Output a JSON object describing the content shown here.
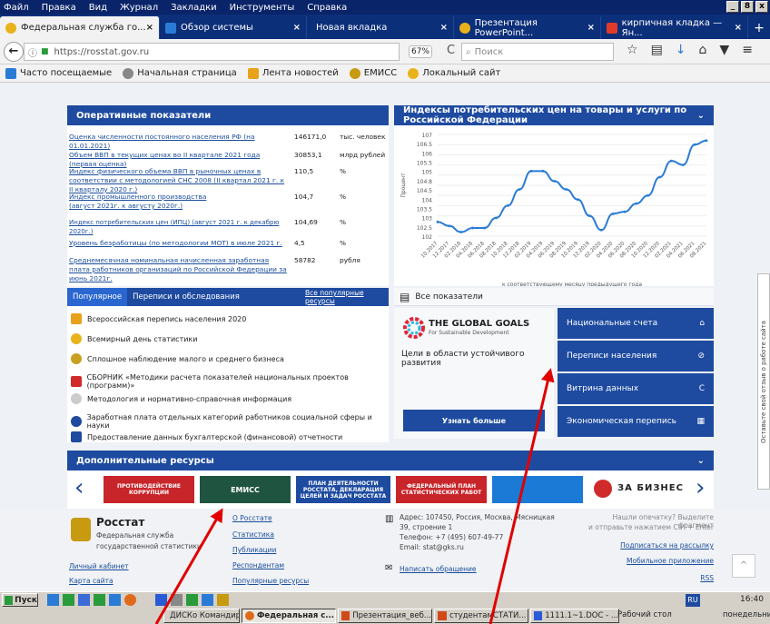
{
  "menu": [
    "Файл",
    "Правка",
    "Вид",
    "Журнал",
    "Закладки",
    "Инструменты",
    "Справка"
  ],
  "window_buttons": [
    "_",
    "8",
    "x"
  ],
  "tabs": [
    {
      "label": "Федеральная служба го...",
      "close": "×",
      "color": "#e8b31a"
    },
    {
      "label": "Обзор системы",
      "close": "×",
      "color": "#2a7bd6"
    },
    {
      "label": "Новая вкладка",
      "close": "×",
      "color": ""
    },
    {
      "label": "Презентация PowerPoint...",
      "close": "×",
      "color": "#e8b31a"
    },
    {
      "label": "кирпичная кладка — Ян...",
      "close": "×",
      "color": "#e03a2a"
    }
  ],
  "new_tab": "+",
  "nav": {
    "back": "←",
    "info": "ⓘ",
    "url": "https://rosstat.gov.ru",
    "zoom": "67%",
    "reload": "C",
    "search_placeholder": "Поиск",
    "icons": [
      "☆",
      "▤",
      "↓",
      "⌂",
      "▼",
      "≡"
    ]
  },
  "bookmarks": [
    {
      "label": "Часто посещаемые",
      "color": "#2a7bd6"
    },
    {
      "label": "Начальная страница",
      "color": "#888"
    },
    {
      "label": "Лента новостей",
      "color": "#e8a21a"
    },
    {
      "label": "ЕМИСС",
      "color": "#c89a10"
    },
    {
      "label": "Локальный сайт",
      "color": "#e8b31a"
    }
  ],
  "indicators": {
    "title": "Оперативные показатели",
    "rows": [
      {
        "label": "Оценка численности постоянного населения РФ (на 01.01.2021)",
        "value": "146171,0",
        "unit": "тыс. человек"
      },
      {
        "label": "Объем ВВП в текущих ценах во II квартале 2021 года (первая оценка)",
        "value": "30853,1",
        "unit": "млрд рублей"
      },
      {
        "label": "Индекс физического объема ВВП в рыночных ценах в соответствии с методологией СНС 2008 (II квартал 2021 г. к II кварталу 2020 г.)",
        "value": "110,5",
        "unit": "%"
      },
      {
        "label": "Индекс промышленного производства (август 2021г. к августу 2020г.)",
        "value": "104,7",
        "unit": "%"
      },
      {
        "label": "Индекс потребительских цен (ИПЦ) (август 2021 г. к декабрю 2020г.)",
        "value": "104,69",
        "unit": "%"
      },
      {
        "label": "Уровень безработицы (по методологии МОТ) в июле 2021 г.",
        "value": "4,5",
        "unit": "%"
      },
      {
        "label": "Среднемесячная номинальная начисленная заработная плата работников организаций по Российской Федерации за июнь 2021г.",
        "value": "58782",
        "unit": "рубля"
      }
    ]
  },
  "cpi_panel": {
    "title": "Индексы потребительских цен на товары и услуги по Российской Федерации",
    "chevron": "⌄"
  },
  "chart_data": {
    "type": "line",
    "title": "",
    "ylabel": "Процент",
    "xlabel": "к соответствующему месяцу предыдущего года",
    "ylim": [
      102,
      107
    ],
    "yticks": [
      "107",
      "106.5",
      "106",
      "105.5",
      "105",
      "104.8",
      "104.5",
      "104",
      "103.5",
      "103",
      "102.5",
      "102"
    ],
    "x": [
      "10.2017",
      "12.2017",
      "02.2018",
      "04.2018",
      "06.2018",
      "08.2018",
      "10.2018",
      "12.2018",
      "02.2019",
      "04.2019",
      "06.2019",
      "08.2019",
      "10.2019",
      "12.2019",
      "02.2020",
      "04.2020",
      "06.2020",
      "08.2020",
      "10.2020",
      "12.2020",
      "02.2021",
      "04.2021",
      "06.2021",
      "08.2021"
    ],
    "series": [
      {
        "values": [
          102.7,
          102.5,
          102.2,
          102.4,
          102.4,
          102.9,
          103.5,
          104.3,
          105.2,
          105.2,
          104.7,
          104.3,
          103.8,
          103.0,
          102.3,
          103.1,
          103.2,
          103.6,
          104.0,
          104.9,
          105.7,
          105.5,
          106.5,
          106.7
        ]
      }
    ],
    "line_color": "#2a7bd6",
    "grid": true
  },
  "popular": {
    "tab_active": "Популярное",
    "tab_other": "Переписи и обследования",
    "all_link": "Все популярные ресурсы",
    "items": [
      {
        "label": "Всероссийская перепись населения 2020",
        "color": "#e8a21a"
      },
      {
        "label": "Всемирный день статистики",
        "color": "#e8b31a"
      },
      {
        "label": "Сплошное наблюдение малого и среднего бизнеса",
        "color": "#c9a020"
      },
      {
        "label": "СБОРНИК «Методики расчета показателей национальных проектов (программ)»",
        "color": "#d02a2a"
      },
      {
        "label": "Методология и нормативно-справочная информация",
        "color": "#888"
      },
      {
        "label": "Заработная плата отдельных категорий работников социальной сферы и науки",
        "color": "#1e4ba0"
      },
      {
        "label": "Предоставление данных бухгалтерской (финансовой) отчетности",
        "color": "#1e4ba0"
      }
    ]
  },
  "all_indicators": {
    "icon": "▤",
    "label": "Все показатели"
  },
  "goals": {
    "logo_title": "THE GLOBAL GOALS",
    "logo_sub": "For Sustainable Development",
    "text": "Цели в области устойчивого развития",
    "button": "Узнать больше"
  },
  "blue_buttons": [
    {
      "label": "Национальные счета",
      "icon": "⌂"
    },
    {
      "label": "Переписи населения",
      "icon": "⊘"
    },
    {
      "label": "Витрина данных",
      "icon": "C"
    },
    {
      "label": "Экономическая перепись",
      "icon": "▦"
    }
  ],
  "additional": {
    "title": "Дополнительные ресурсы",
    "chevron": "⌄"
  },
  "carousel": {
    "prev": "‹",
    "next": "›",
    "banners": [
      {
        "text": "ПРОТИВОДЕЙСТВИЕ КОРРУПЦИИ",
        "color": "#c8252a"
      },
      {
        "text": "ЕМИСС",
        "color": "#1f5540"
      },
      {
        "text": "ПЛАН ДЕЯТЕЛЬНОСТИ РОССТАТА, ДЕКЛАРАЦИЯ ЦЕЛЕЙ И ЗАДАЧ РОССТАТА",
        "color": "#1e4ba0"
      },
      {
        "text": "ФЕДЕРАЛЬНЫЙ ПЛАН СТАТИСТИЧЕСКИХ РАБОТ",
        "color": "#c8252a"
      },
      {
        "text": "",
        "color": "#1a7ad6"
      }
    ],
    "business": "ЗА БИЗНЕС"
  },
  "footer": {
    "org": "Росстат",
    "org_sub1": "Федеральная служба",
    "org_sub2": "государственной статистики",
    "cabinet": "Личный кабинет",
    "sitemap": "Карта сайта",
    "links": [
      "О Росстате",
      "Статистика",
      "Публикации",
      "Респондентам",
      "Популярные ресурсы"
    ],
    "address1": "Адрес: 107450, Россия, Москва, Мясницкая",
    "address2": "39, строение 1",
    "phone": "Телефон: +7 (495) 607-49-77",
    "email": "Email: stat@gks.ru",
    "appeal": "Написать обращение",
    "typo1": "Нашли опечатку? Выделите фрагмент",
    "typo2": "и отправьте нажатием Ctrl + Enter",
    "subscribe": "Подписаться на рассылку",
    "mobile": "Мобильное приложение",
    "rss": "RSS",
    "up": "^"
  },
  "feedback_tab": "Оставьте свой отзыв о работе сайта",
  "taskbar": {
    "start": "Пуск",
    "lang": "RU",
    "time": "16:40",
    "buttons": [
      {
        "label": "ДИСКо Командир ...",
        "color": "#0b5ea8"
      },
      {
        "label": "Федеральная с...",
        "color": "#e06a1a"
      },
      {
        "label": "Презентация_веб...",
        "color": "#d04a1a"
      },
      {
        "label": "студентамСТАТИ...",
        "color": "#d04a1a"
      },
      {
        "label": "1111.1~1.DOC - ...",
        "color": "#2a5bd6"
      }
    ],
    "desktop": "Рабочий стол",
    "weekday": "понедельни"
  }
}
